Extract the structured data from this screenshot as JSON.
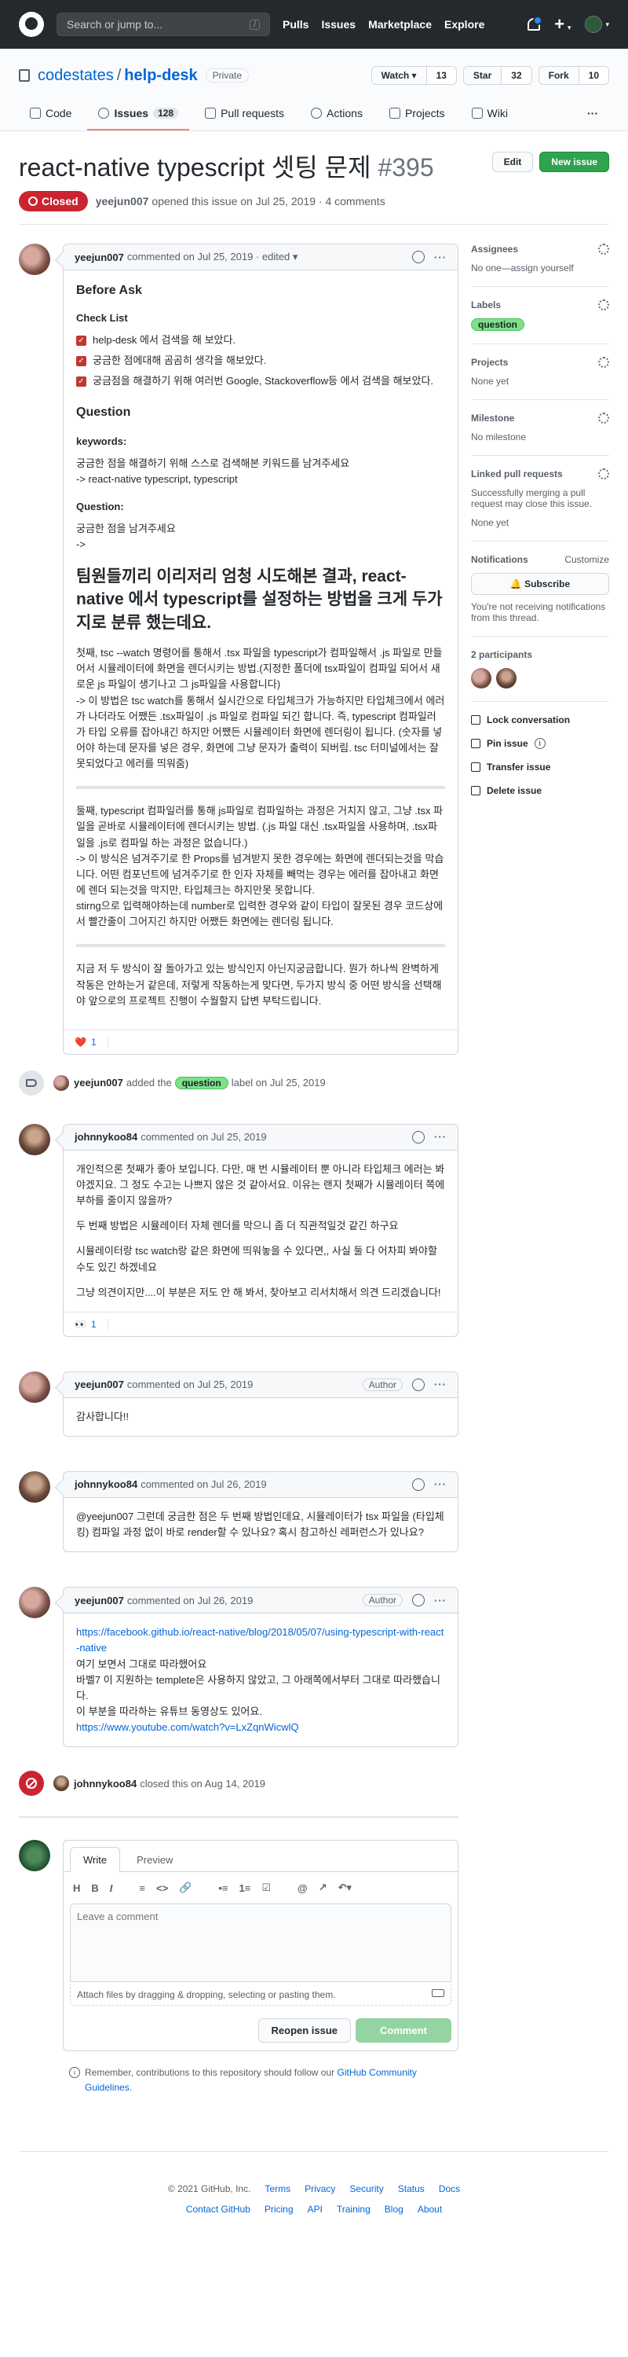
{
  "header": {
    "search_placeholder": "Search or jump to...",
    "search_key": "/",
    "nav": [
      "Pulls",
      "Issues",
      "Marketplace",
      "Explore"
    ],
    "plus": "+",
    "caret": "▾"
  },
  "repo": {
    "owner": "codestates",
    "separator": "/",
    "name": "help-desk",
    "visibility": "Private",
    "watch_label": "Watch ▾",
    "watch_count": "13",
    "star_label": "Star",
    "star_count": "32",
    "fork_label": "Fork",
    "fork_count": "10"
  },
  "tabs": {
    "code": "Code",
    "issues": "Issues",
    "issues_count": "128",
    "pulls": "Pull requests",
    "actions": "Actions",
    "projects": "Projects",
    "wiki": "Wiki",
    "more": "···"
  },
  "issue": {
    "title": "react-native typescript 셋팅 문제",
    "number": "#395",
    "edit_label": "Edit",
    "new_issue_label": "New issue",
    "state": "Closed",
    "author": "yeejun007",
    "meta": "opened this issue on Jul 25, 2019 · 4 comments"
  },
  "first_comment": {
    "author": "yeejun007",
    "meta": "commented on Jul 25, 2019 · edited ▾",
    "before_ask": "Before Ask",
    "check_list": "Check List",
    "checks": [
      "help-desk 에서 검색을 해 보았다.",
      "궁금한 점에대해 곰곰히 생각을 해보았다.",
      "궁금점을 해결하기 위해 여러번 Google, Stackoverflow등 에서 검색을 해보았다."
    ],
    "question_heading": "Question",
    "keywords_heading": "keywords:",
    "keywords_line1": "궁금한 점을 해결하기 위해 스스로 검색해본 키워드를 남겨주세요",
    "keywords_line2": "-> react-native typescript, typescript",
    "question_sub": "Question:",
    "question_line1": "궁금한 점을 남겨주세요",
    "question_line2": "->",
    "big_heading": "팀원들끼리 이리저리 엄청 시도해본 결과, react-native 에서 typescript를 설정하는 방법을 크게 두가지로 분류 했는데요.",
    "para1": "첫째, tsc --watch 명령어를 통해서 .tsx 파일을 typescript가 컴파일해서 .js 파일로 만들어서 시뮬레이터에 화면을 렌더시키는 방법.(지정한 폴더에 tsx파일이 컴파일 되어서 새로운 js 파일이 생기나고 그 js파일을 사용합니다)\n-> 이 방법은 tsc watch를 통해서 실시간으로 타입체크가 가능하지만 타입체크에서 에러가 나더라도 어쨌든 .tsx파일이 .js 파일로 컴파일 되긴 합니다. 즉, typescript 컴파일러가 타입 오류를 잡아내긴 하지만 어쨌든 시뮬레이터 화면에 렌더링이 됩니다. (숫자를 넣어야 하는데 문자를 넣은 경우, 화면에 그냥 문자가 출력이 되버림. tsc 터미널에서는 잘못되었다고 에러를 띄워줌)",
    "para2": "둘째, typescript 컴파일러를 통해 js파일로 컴파일하는 과정은 거치지 않고, 그냥 .tsx 파일을 곧바로 시뮬레이터에 렌더시키는 방법. (.js 파일 대신 .tsx파일을 사용하며, .tsx파일을 .js로 컴파일 하는 과정은 없습니다.)\n-> 이 방식은 넘겨주기로 한 Props를 넘겨받지 못한 경우에는 화면에 렌더되는것을 막습니다. 어떤 컴포넌트에 넘겨주기로 한 인자 자체를 빼먹는 경우는 에러를 잡아내고 화면에 렌더 되는것을 막지만, 타입체크는 하지만못 못합니다.\nstirng으로 입력해야하는데 number로 입력한 경우와 같이 타입이 잘못된 경우 코드상에서 빨간줄이 그어지긴 하지만 어쨌든 화면에는 렌더링 됩니다.",
    "para3": "지금 저 두 방식이 잘 돌아가고 있는 방식인지 아닌지궁금합니다. 뭔가 하나씩 완벽하게 작동은 안하는거 같은데, 저렇게 작동하는게 맞다면, 두가지 방식 중 어떤 방식을 선택해야 앞으로의 프로젝트 진행이 수월할지 답변 부탁드립니다.",
    "reaction_emoji": "❤️",
    "reaction_count": "1"
  },
  "label_event": {
    "actor": "yeejun007",
    "before": "added the",
    "label": "question",
    "after": "label on Jul 25, 2019"
  },
  "comments": [
    {
      "author": "johnnykoo84",
      "meta": "commented on Jul 25, 2019",
      "p1": "개인적으론 첫째가 좋아 보입니다. 다만, 매 번 시뮬레이터 뿐 아니라 타입체크 에러는 봐야겠지요. 그 정도 수고는 나쁘지 않은 것 같아서요. 이유는 랜지 첫째가 시뮬레이터 쪽에 부하를 줄이지 않을까?",
      "p2": "두 번째 방법은 시뮬레이터 자체 렌더를 막으니 좀 더 직관적일것 같긴 하구요",
      "p3": "시뮬레이터랑 tsc watch랑 같은 화면에 띄워놓을 수 있다면,, 사실 둘 다 어차피 봐야할 수도 있긴 하겠네요",
      "p4": "그냥 의견이지만....이 부분은 저도 안 해 봐서, 찾아보고 리서치해서 의견 드리겠습니다!",
      "reaction_emoji": "👀",
      "reaction_count": "1"
    },
    {
      "author": "yeejun007",
      "meta": "commented on Jul 25, 2019",
      "role": "Author",
      "p1": "감사합니다!!"
    },
    {
      "author": "johnnykoo84",
      "meta": "commented on Jul 26, 2019",
      "p1": "@yeejun007 그런데 궁금한 점은 두 번째 방법인데요, 시뮬레이터가 tsx 파일을 (타입체킹) 컴파일 과정 없이 바로 render할 수 있나요? 혹시 참고하신 레퍼런스가 있나요?"
    },
    {
      "author": "yeejun007",
      "meta": "commented on Jul 26, 2019",
      "role": "Author",
      "link1": "https://facebook.github.io/react-native/blog/2018/05/07/using-typescript-with-react-native",
      "line2": "여기 보면서 그대로 따라했어요",
      "line3": "바벨7 이 지원하는 templete은 사용하지 않았고, 그 아래쪽에서부터 그대로 따라했습니다.",
      "line4": "이 부분을 따라하는 유튜브 동영상도 있어요.",
      "link2": "https://www.youtube.com/watch?v=LxZqnWicwlQ"
    }
  ],
  "closed_event": {
    "actor": "johnnykoo84",
    "text": "closed this on Aug 14, 2019"
  },
  "sidebar": {
    "assignees_title": "Assignees",
    "assignees_value": "No one—assign yourself",
    "labels_title": "Labels",
    "label": "question",
    "projects_title": "Projects",
    "projects_value": "None yet",
    "milestone_title": "Milestone",
    "milestone_value": "No milestone",
    "linked_title": "Linked pull requests",
    "linked_desc": "Successfully merging a pull request may close this issue.",
    "linked_value": "None yet",
    "notifications_title": "Notifications",
    "customize": "Customize",
    "subscribe": "🔔 Subscribe",
    "notif_desc": "You're not receiving notifications from this thread.",
    "participants_title": "2 participants",
    "lock": "Lock conversation",
    "pin": "Pin issue",
    "pin_info": "i",
    "transfer": "Transfer issue",
    "delete": "Delete issue"
  },
  "editor": {
    "write_tab": "Write",
    "preview_tab": "Preview",
    "tools": [
      "H",
      "B",
      "I",
      "≡",
      "<>",
      "🔗",
      "•≡",
      "1≡",
      "☑",
      "@",
      "↗",
      "↶▾"
    ],
    "placeholder": "Leave a comment",
    "attach_text": "Attach files by dragging & dropping, selecting or pasting them.",
    "reopen_label": "Reopen issue",
    "comment_label": "Comment",
    "remember_info": "i",
    "remember_text": "Remember, contributions to this repository should follow our",
    "remember_link": "GitHub Community Guidelines",
    "remember_end": "."
  },
  "footer": {
    "row1": [
      "© 2021 GitHub, Inc.",
      "Terms",
      "Privacy",
      "Security",
      "Status",
      "Docs"
    ],
    "row2": [
      "Contact GitHub",
      "Pricing",
      "API",
      "Training",
      "Blog",
      "About"
    ]
  },
  "colors": {
    "header_bg": "#24292e",
    "closed_red": "#cb2431",
    "green": "#2ea44f",
    "link_blue": "#0366d6",
    "question_label": "#7ee08a"
  }
}
